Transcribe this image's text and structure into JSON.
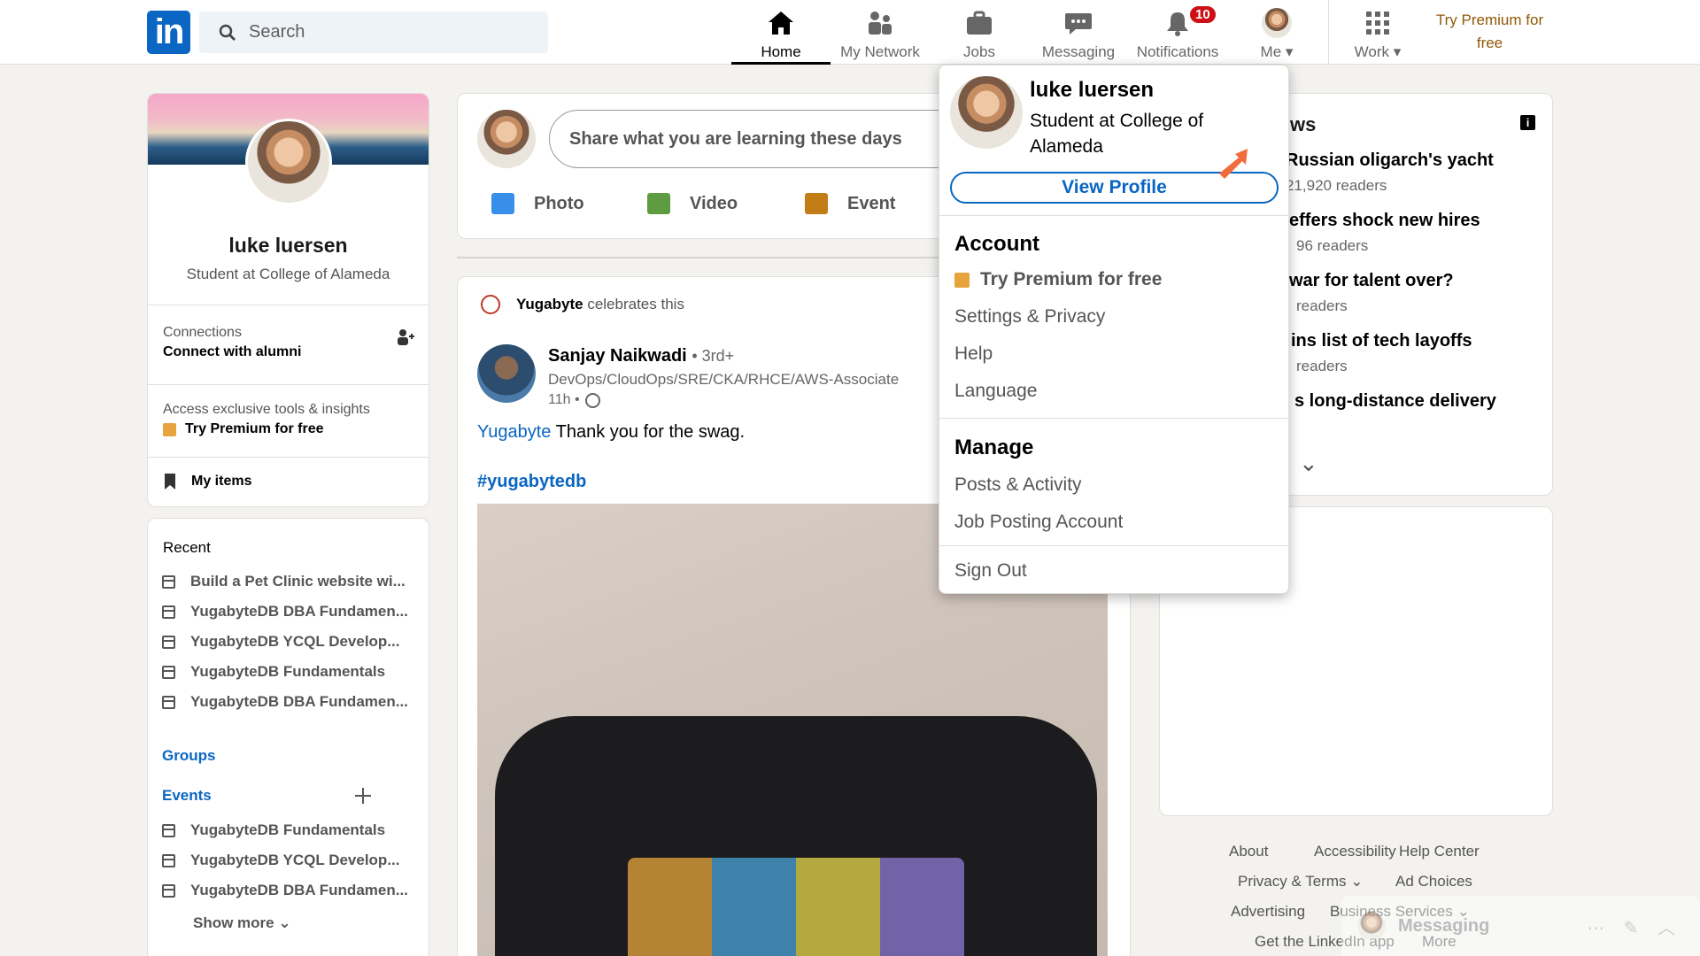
{
  "topbar": {
    "logo": "in",
    "search_placeholder": "Search",
    "nav": [
      {
        "label": "Home",
        "icon": "home-icon"
      },
      {
        "label": "My Network",
        "icon": "network-icon"
      },
      {
        "label": "Jobs",
        "icon": "briefcase-icon"
      },
      {
        "label": "Messaging",
        "icon": "messaging-icon"
      },
      {
        "label": "Notifications",
        "icon": "bell-icon",
        "badge": "10"
      },
      {
        "label": "Me",
        "icon": "avatar"
      },
      {
        "label": "Work",
        "icon": "grid-icon"
      }
    ],
    "premium_line1": "Try Premium for",
    "premium_line2": "free"
  },
  "profile_card": {
    "name": "luke luersen",
    "headline": "Student at College of Alameda",
    "connections_label": "Connections",
    "connections_sub": "Connect with alumni",
    "premium_note": "Access exclusive tools & insights",
    "premium_cta": "Try Premium for free",
    "my_items": "My items"
  },
  "recent_card": {
    "recent_label": "Recent",
    "recent_items": [
      "Build a Pet Clinic website wi...",
      "YugabyteDB DBA Fundamen...",
      "YugabyteDB YCQL Develop...",
      "YugabyteDB Fundamentals",
      "YugabyteDB DBA Fundamen..."
    ],
    "groups_label": "Groups",
    "events_label": "Events",
    "event_items": [
      "YugabyteDB Fundamentals",
      "YugabyteDB YCQL Develop...",
      "YugabyteDB DBA Fundamen..."
    ],
    "show_more": "Show more"
  },
  "share_box": {
    "placeholder": "Share what you are learning these days",
    "actions": [
      "Photo",
      "Video",
      "Event"
    ]
  },
  "post": {
    "celebrates_org": "Yugabyte",
    "celebrates_text": "celebrates this",
    "author": "Sanjay Naikwadi",
    "degree": "• 3rd+",
    "headline": "DevOps/CloudOps/SRE/CKA/RHCE/AWS-Associate",
    "time": "11h •",
    "mention": "Yugabyte",
    "body": "Thank you for the swag.",
    "hashtag": "#yugabytedb"
  },
  "me_dropdown": {
    "name": "luke luersen",
    "headline_line1": "Student at College of",
    "headline_line2": "Alameda",
    "view_profile": "View Profile",
    "account_heading": "Account",
    "account_items": [
      "Try Premium for free",
      "Settings & Privacy",
      "Help",
      "Language"
    ],
    "manage_heading": "Manage",
    "manage_items": [
      "Posts & Activity",
      "Job Posting Account"
    ],
    "sign_out": "Sign Out"
  },
  "news_card": {
    "heading_fragment": "ws",
    "items": [
      {
        "title": "Russian oligarch's yacht",
        "sub": "21,920 readers"
      },
      {
        "title": "effers shock new hires",
        "sub": "96 readers"
      },
      {
        "title": "war for talent over?",
        "sub": "readers"
      },
      {
        "title": "ins list of tech layoffs",
        "sub": "readers"
      },
      {
        "title": "s long-distance delivery",
        "sub": ""
      }
    ]
  },
  "footer": {
    "row1": [
      "About",
      "Accessibility",
      "Help Center"
    ],
    "row2": [
      "Privacy & Terms",
      "Ad Choices"
    ],
    "row3": [
      "Advertising",
      "Business Services"
    ],
    "row4": [
      "Get the LinkedIn app",
      "More"
    ],
    "messaging_label": "Messaging"
  },
  "colors": {
    "brand": "#0a66c2",
    "premium": "#915907",
    "badge": "#cc1016",
    "arrow": "#f26b3a"
  }
}
